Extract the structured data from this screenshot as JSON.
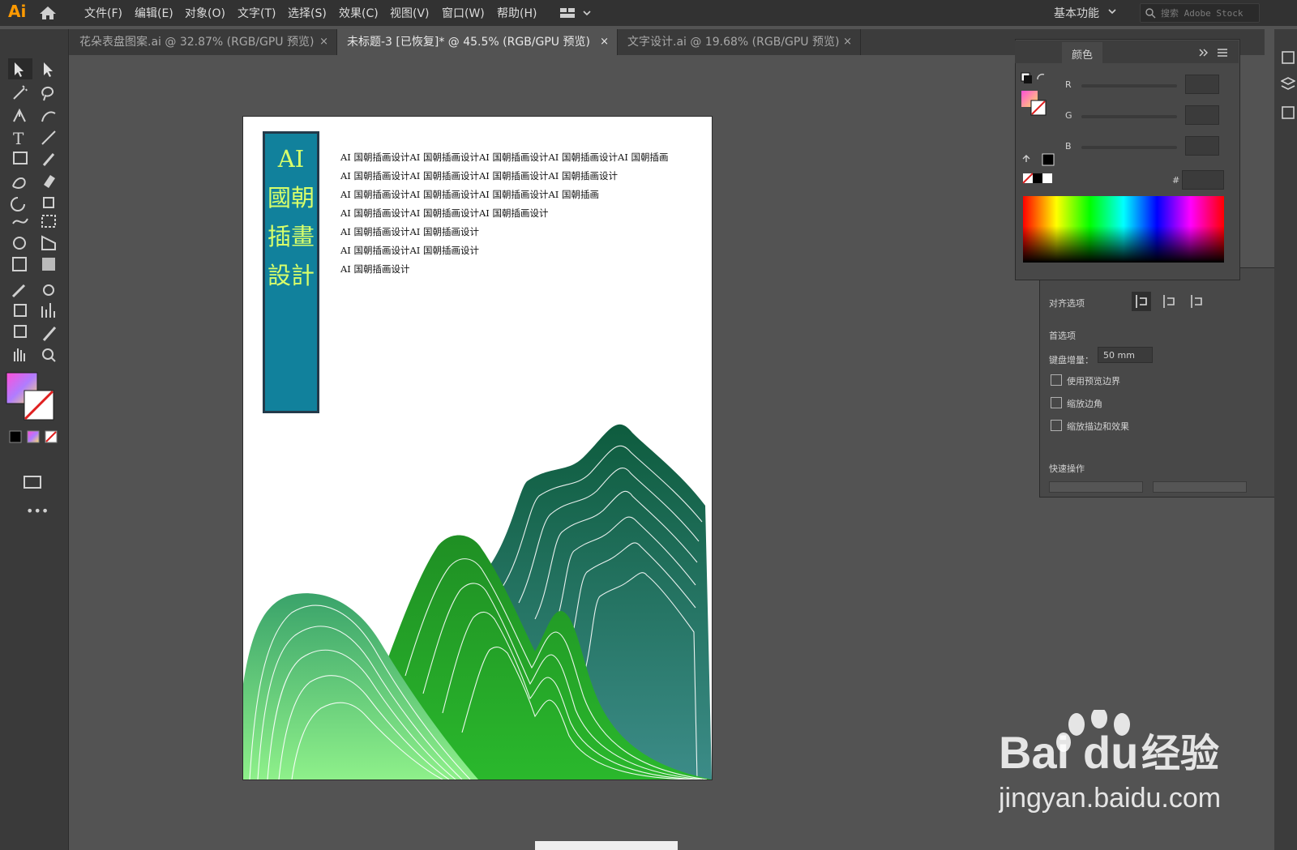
{
  "app": {
    "logo": "Ai"
  },
  "menu": [
    "文件(F)",
    "编辑(E)",
    "对象(O)",
    "文字(T)",
    "选择(S)",
    "效果(C)",
    "视图(V)",
    "窗口(W)",
    "帮助(H)"
  ],
  "workspace": "基本功能",
  "search_placeholder": "搜索 Adobe Stock",
  "tabs": [
    {
      "label": "花朵表盘图案.ai @ 32.87% (RGB/GPU 预览)",
      "active": false
    },
    {
      "label": "未标题-3 [已恢复]* @ 45.5% (RGB/GPU 预览)",
      "active": true
    },
    {
      "label": "文字设计.ai @ 19.68% (RGB/GPU 预览)",
      "active": false
    }
  ],
  "tab_close": "×",
  "artwork": {
    "banner_title": "AI國朝插畫設計",
    "body_lines": [
      "AI 国朝插画设计AI 国朝插画设计AI 国朝插画设计AI 国朝插画设计AI 国朝插画",
      "AI 国朝插画设计AI 国朝插画设计AI 国朝插画设计AI 国朝插画设计",
      "AI 国朝插画设计AI 国朝插画设计AI 国朝插画设计AI 国朝插画",
      "AI 国朝插画设计AI 国朝插画设计AI 国朝插画设计",
      "AI 国朝插画设计AI 国朝插画设计",
      "AI 国朝插画设计AI 国朝插画设计",
      "AI 国朝插画设计"
    ],
    "colors": {
      "banner": "#11819c",
      "title": "#d8ff6a",
      "mountain_dark": "#0e5c3e",
      "mountain_mid": "#1f8f24",
      "mountain_light": "#8ef08a"
    }
  },
  "color_panel": {
    "tab": "颜色",
    "channels": [
      "R",
      "G",
      "B"
    ],
    "hex_label": "#"
  },
  "properties": {
    "align_label": "对齐选项",
    "prefs_title": "首选项",
    "keyboard_inc_label": "键盘增量：",
    "keyboard_inc_value": "50 mm",
    "checkboxes": [
      "使用预览边界",
      "缩放边角",
      "缩放描边和效果"
    ],
    "quick_title": "快速操作"
  },
  "watermark": {
    "brand": "Bai",
    "du": "du",
    "cn": "经验",
    "url": "jingyan.baidu.com"
  }
}
